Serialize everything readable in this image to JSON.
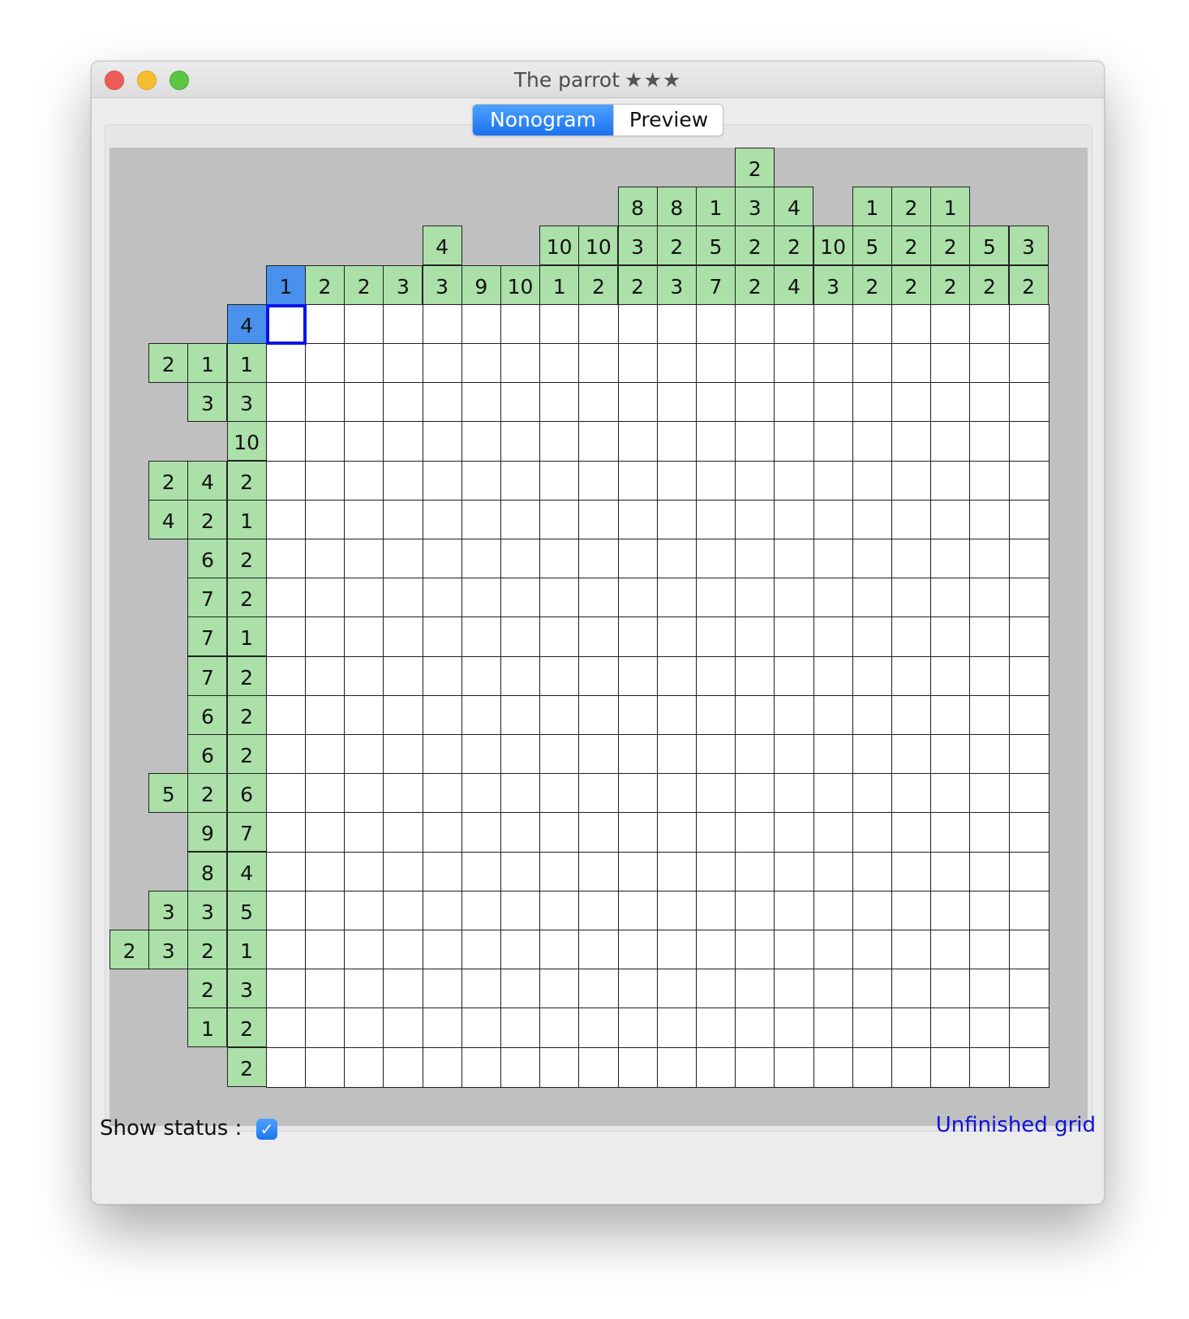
{
  "window": {
    "title": "The parrot",
    "stars": "★★★",
    "traffic_lights": [
      "close",
      "minimize",
      "zoom"
    ]
  },
  "tabs": [
    {
      "label": "Nonogram",
      "active": true
    },
    {
      "label": "Preview",
      "active": false
    }
  ],
  "puzzle": {
    "size": 20,
    "column_clues": [
      [
        1
      ],
      [
        2
      ],
      [
        2
      ],
      [
        3
      ],
      [
        4,
        3
      ],
      [
        9
      ],
      [
        10
      ],
      [
        10,
        1
      ],
      [
        10,
        2
      ],
      [
        8,
        3,
        2
      ],
      [
        8,
        2,
        3
      ],
      [
        1,
        5,
        7
      ],
      [
        2,
        3,
        2,
        2
      ],
      [
        4,
        2,
        4
      ],
      [
        10,
        3
      ],
      [
        1,
        5,
        2
      ],
      [
        2,
        2,
        2
      ],
      [
        1,
        2,
        2
      ],
      [
        5,
        2
      ],
      [
        3,
        2
      ]
    ],
    "row_clues": [
      [
        4
      ],
      [
        2,
        1,
        1
      ],
      [
        3,
        3
      ],
      [
        10
      ],
      [
        2,
        4,
        2
      ],
      [
        4,
        2,
        1
      ],
      [
        6,
        2
      ],
      [
        7,
        2
      ],
      [
        7,
        1
      ],
      [
        7,
        2
      ],
      [
        6,
        2
      ],
      [
        6,
        2
      ],
      [
        5,
        2,
        6
      ],
      [
        9,
        7
      ],
      [
        8,
        4
      ],
      [
        3,
        3,
        5
      ],
      [
        2,
        3,
        2,
        1
      ],
      [
        2,
        3
      ],
      [
        1,
        2
      ],
      [
        2
      ]
    ],
    "highlighted_column": 0,
    "highlighted_row": 0,
    "selected_cell": {
      "row": 0,
      "col": 0
    },
    "colors": {
      "clue_fill": "#abe0a9",
      "clue_highlight": "#4a91ee",
      "selection": "#0a14ec",
      "background": "#c0c0c0"
    }
  },
  "footer": {
    "show_status_label": "Show status :",
    "show_status_checked": true,
    "status_text": "Unfinished grid"
  }
}
